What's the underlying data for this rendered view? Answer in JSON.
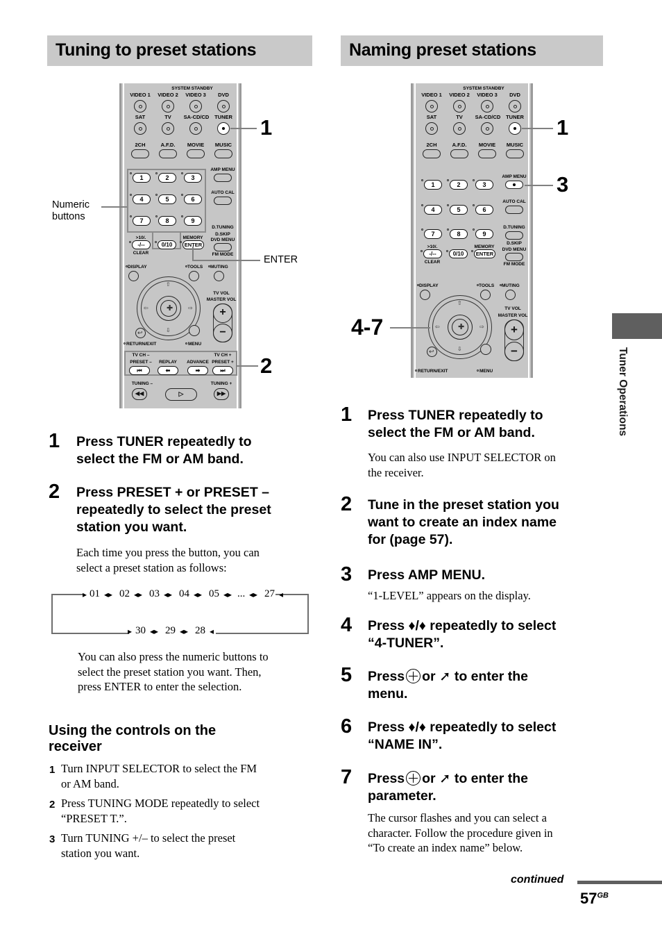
{
  "page": {
    "number": "57",
    "region_suffix": "GB",
    "continued_label": "continued",
    "side_tab_label": "Tuner Operations"
  },
  "left_column": {
    "heading": "Tuning to preset stations",
    "callouts": {
      "numeric_buttons": "Numeric\nbuttons",
      "numeric_buttons_line1": "Numeric",
      "numeric_buttons_line2": "buttons",
      "enter": "ENTER",
      "step1": "1",
      "step2": "2"
    },
    "steps": [
      {
        "num": "1",
        "head_line1": "Press TUNER repeatedly to",
        "head_line2": "select the FM or AM band.",
        "body": []
      },
      {
        "num": "2",
        "head_line1": "Press PRESET + or PRESET –",
        "head_line2": "repeatedly to select the preset",
        "head_line3": "station you want.",
        "body": [
          "Each time you press the button, you can",
          "select a preset station as follows:"
        ]
      }
    ],
    "after_diagram_body": [
      "You can also press the numeric buttons to",
      "select the preset station you want. Then,",
      "press ENTER to enter the selection."
    ],
    "subsection": {
      "heading_line1": "Using the controls on the",
      "heading_line2": "receiver",
      "steps": [
        {
          "num": "1",
          "lines": [
            "Turn INPUT SELECTOR to select the FM",
            "or AM band."
          ]
        },
        {
          "num": "2",
          "lines": [
            "Press TUNING MODE repeatedly to select",
            "“PRESET T.”."
          ]
        },
        {
          "num": "3",
          "lines": [
            "Turn TUNING +/– to select the preset",
            "station you want."
          ]
        }
      ]
    }
  },
  "right_column": {
    "heading": "Naming preset stations",
    "callouts": {
      "step1": "1",
      "step3": "3",
      "steps47": "4-7"
    },
    "steps": [
      {
        "num": "1",
        "head_line1": "Press TUNER repeatedly to",
        "head_line2": "select the FM or AM band.",
        "body": [
          "You can also use INPUT SELECTOR on",
          "the receiver."
        ]
      },
      {
        "num": "2",
        "head_line1": "Tune in the preset station you",
        "head_line2": "want to create an index name",
        "head_line3": "for (page 57).",
        "body": []
      },
      {
        "num": "3",
        "head_line1": "Press AMP MENU.",
        "body": [
          "“1-LEVEL” appears on the display."
        ]
      },
      {
        "num": "4",
        "head_line1": "Press ♦/♦ repeatedly to select",
        "head_line2": "“4-TUNER”.",
        "body": []
      },
      {
        "num": "5",
        "head_pre": "Press",
        "head_mid": "or",
        "head_post": "to enter the",
        "head_line2": "menu.",
        "body": []
      },
      {
        "num": "6",
        "head_line1": "Press ♦/♦ repeatedly to select",
        "head_line2": "“NAME IN”.",
        "body": []
      },
      {
        "num": "7",
        "head_pre": "Press",
        "head_mid": "or",
        "head_post": "to enter the",
        "head_line2": "parameter.",
        "body": [
          "The cursor flashes and you can select a",
          "character. Follow the procedure given in",
          "“To create an index name” below."
        ]
      }
    ]
  },
  "preset_cycle": {
    "top_row": [
      "01",
      "02",
      "03",
      "04",
      "05",
      "...",
      "27"
    ],
    "bottom_row": [
      "30",
      "29",
      "28"
    ]
  },
  "remote": {
    "source_labels_row1": [
      "VIDEO 1",
      "VIDEO 2",
      "VIDEO 3",
      "DVD"
    ],
    "system_standby": "SYSTEM STANDBY",
    "source_labels_row2": [
      "SAT",
      "TV",
      "SA-CD/CD",
      "TUNER"
    ],
    "mode_labels": [
      "2CH",
      "A.F.D.",
      "MOVIE",
      "MUSIC"
    ],
    "numeric": [
      "1",
      "2",
      "3",
      "4",
      "5",
      "6",
      "7",
      "8",
      "9"
    ],
    "num_extra": {
      "gt10": ">10/.",
      "dashes": "-/--",
      "clear": "CLEAR",
      "zero": "0/10",
      "memory": "MEMORY",
      "enter": "ENTER"
    },
    "right_side": [
      "AMP MENU",
      "AUTO CAL",
      "D.TUNING",
      "D.SKIP",
      "DVD MENU",
      "FM MODE"
    ],
    "mid_labels": [
      "DISPLAY",
      "TOOLS",
      "MUTING"
    ],
    "vol_labels": [
      "TV VOL",
      "MASTER VOL"
    ],
    "bottom_labels": [
      "RETURN/EXIT",
      "MENU"
    ],
    "transport": {
      "tv_ch_minus": "TV CH –",
      "preset_minus": "PRESET –",
      "replay": "REPLAY",
      "advance": "ADVANCE",
      "tv_ch_plus": "TV CH +",
      "preset_plus": "PRESET +",
      "tuning_minus": "TUNING –",
      "tuning_plus": "TUNING +"
    }
  },
  "colors": {
    "header_bg": "#c9c9c9",
    "remote_body": "#c6c6c6",
    "callout_line": "#808080",
    "side_tab": "#5f5f5f"
  }
}
